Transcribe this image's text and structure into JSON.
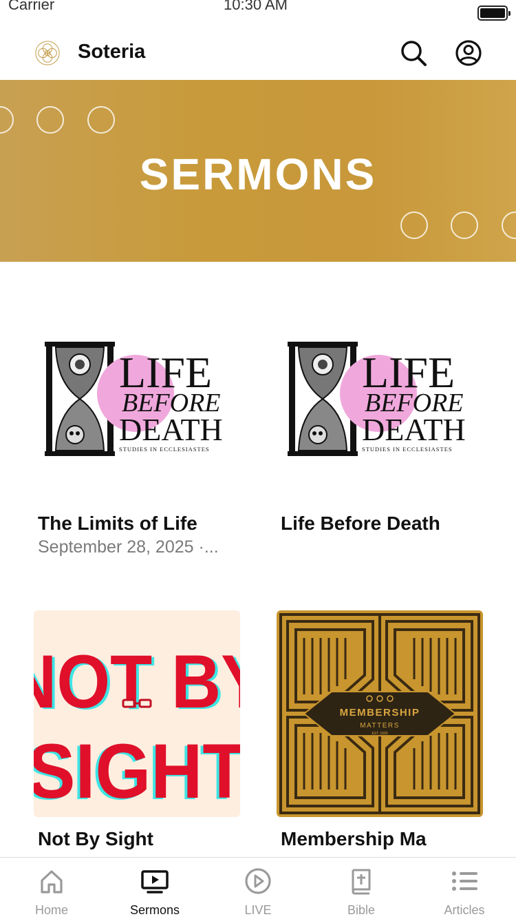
{
  "status_bar": {
    "carrier": "Carrier",
    "time": "10:30 AM"
  },
  "header": {
    "app_title": "Soteria"
  },
  "banner": {
    "title": "SERMONS"
  },
  "sermons": [
    {
      "title": "The Limits of Life",
      "subtitle": "September 28, 2025 ·..."
    },
    {
      "title": "Life Before Death",
      "subtitle": ""
    },
    {
      "title": "Not By Sight",
      "subtitle": ""
    },
    {
      "title": "Membership Ma",
      "subtitle": ""
    }
  ],
  "artwork": {
    "life_before_death": {
      "line1": "LIFE",
      "line2": "BEFORE",
      "line3": "DEATH",
      "caption": "STUDIES IN ECCLESIASTES"
    },
    "not_by_sight": {
      "line1": "NOT BY",
      "line2": "SIGHT"
    },
    "membership": {
      "line1": "MEMBERSHIP",
      "line2": "MATTERS",
      "est": "EST. 1600"
    }
  },
  "tabs": [
    {
      "label": "Home",
      "icon": "home-icon"
    },
    {
      "label": "Sermons",
      "icon": "tv-play-icon",
      "active": true
    },
    {
      "label": "LIVE",
      "icon": "play-circle-icon"
    },
    {
      "label": "Bible",
      "icon": "bible-icon"
    },
    {
      "label": "Articles",
      "icon": "list-icon"
    }
  ],
  "colors": {
    "banner_gold": "#c89a3a",
    "active_tab": "#111111",
    "inactive_tab": "#9a9a9a",
    "highlight_pink": "#f0a8dc"
  }
}
